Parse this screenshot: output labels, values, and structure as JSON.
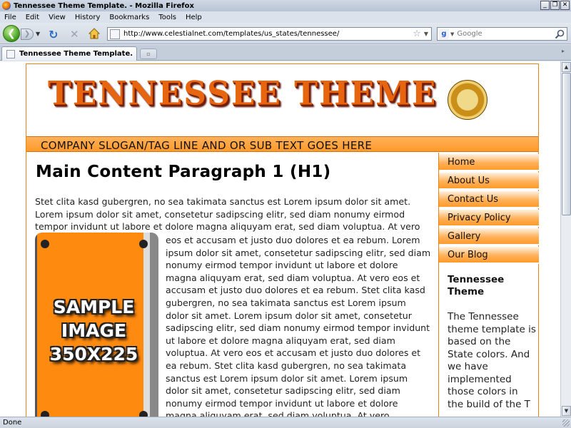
{
  "window": {
    "title": "Tennessee Theme Template. - Mozilla Firefox"
  },
  "menu": [
    "File",
    "Edit",
    "View",
    "History",
    "Bookmarks",
    "Tools",
    "Help"
  ],
  "toolbar": {
    "url": "http://www.celestialnet.com/templates/us_states/tennessee/",
    "search_placeholder": "Google"
  },
  "tabs": [
    {
      "label": "Tennessee Theme Template."
    }
  ],
  "page": {
    "logo_text": "TENNESSEE THEME",
    "slogan": "COMPANY SLOGAN/TAG LINE AND OR SUB TEXT GOES HERE",
    "heading": "Main Content Paragraph 1 (H1)",
    "paragraph_top": "Stet clita kasd gubergren, no sea takimata sanctus est Lorem ipsum dolor sit amet. Lorem ipsum dolor sit amet, consetetur sadipscing elitr, sed diam nonumy eirmod tempor invidunt ut labore et dolore magna aliquyam erat, sed diam voluptua. At vero",
    "paragraph_wrap": "eos et accusam et justo duo dolores et ea rebum. Lorem ipsum dolor sit amet, consetetur sadipscing elitr, sed diam nonumy eirmod tempor invidunt ut labore et dolore magna aliquyam erat, sed diam voluptua. At vero eos et accusam et justo duo dolores et ea rebum. Stet clita kasd gubergren, no sea takimata sanctus est Lorem ipsum dolor sit amet. Lorem ipsum dolor sit amet, consetetur sadipscing elitr, sed diam nonumy eirmod tempor invidunt ut labore et dolore magna aliquyam erat, sed diam voluptua. At vero eos et accusam et justo duo dolores et ea rebum. Stet clita kasd gubergren, no sea takimata sanctus est Lorem ipsum dolor sit amet. Lorem ipsum dolor sit amet, consetetur sadipscing elitr, sed diam nonumy eirmod tempor invidunt ut labore et dolore magna aliquyam erat, sed diam voluptua. At vero",
    "sample_image": {
      "line1": "SAMPLE",
      "line2": "IMAGE",
      "line3": "350X225",
      "color": "#ff8a10"
    },
    "nav": [
      "Home",
      "About Us",
      "Contact Us",
      "Privacy Policy",
      "Gallery",
      "Our Blog"
    ],
    "sidebar_heading": "Tennessee Theme",
    "sidebar_text": "The Tennessee theme template is based on the State colors. And we have implemented those colors in the build of the T",
    "accent_color": "#ff9a2a"
  },
  "status": {
    "text": "Done"
  }
}
